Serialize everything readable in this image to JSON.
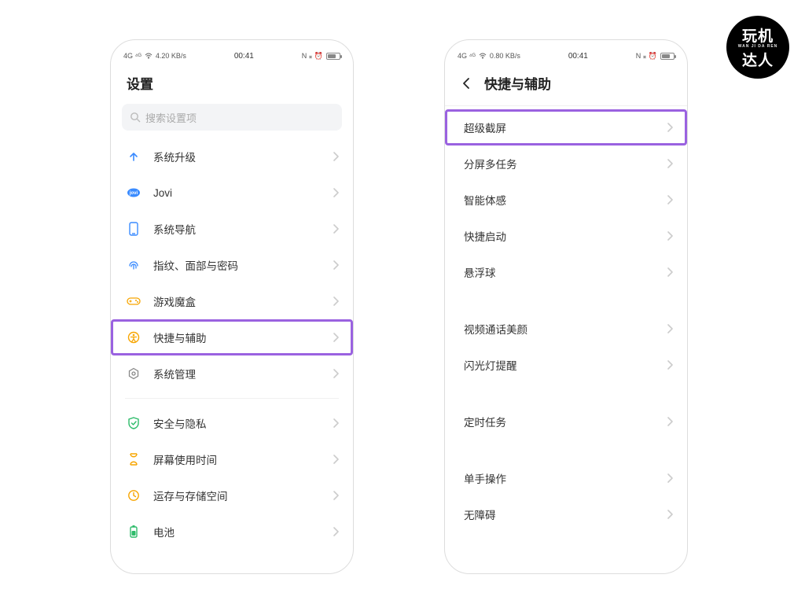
{
  "status": {
    "left_text_a": "4G ⁴ᴳ",
    "left_text_b": "4.20 KB/s",
    "left_text_b2": "0.80 KB/s",
    "time": "00:41",
    "right_icons": "N ⁎ ⏰"
  },
  "badge": {
    "line1": "玩机",
    "sub": "WAN JI DA REN",
    "line2": "达人"
  },
  "phone1": {
    "title": "设置",
    "search_placeholder": "搜索设置项",
    "groups": [
      [
        {
          "key": "upgrade",
          "label": "系统升级",
          "icon": "arrow-up",
          "color": "#3a8bff"
        },
        {
          "key": "jovi",
          "label": "Jovi",
          "icon": "jovi",
          "color": "#3a8bff"
        },
        {
          "key": "nav",
          "label": "系统导航",
          "icon": "phone-rect",
          "color": "#3a8bff"
        },
        {
          "key": "biometric",
          "label": "指纹、面部与密码",
          "icon": "fingerprint",
          "color": "#3a8bff"
        },
        {
          "key": "gamebox",
          "label": "游戏魔盒",
          "icon": "gamepad",
          "color": "#f7a500"
        },
        {
          "key": "shortcut",
          "label": "快捷与辅助",
          "icon": "accessibility",
          "color": "#f7a500",
          "highlighted": true
        },
        {
          "key": "sysmgr",
          "label": "系统管理",
          "icon": "gear-hex",
          "color": "#888"
        }
      ],
      [
        {
          "key": "security",
          "label": "安全与隐私",
          "icon": "shield",
          "color": "#2dbb6a"
        },
        {
          "key": "screentime",
          "label": "屏幕使用时间",
          "icon": "hourglass",
          "color": "#f7a500"
        },
        {
          "key": "storage",
          "label": "运存与存储空间",
          "icon": "clock-store",
          "color": "#f7a500"
        },
        {
          "key": "battery",
          "label": "电池",
          "icon": "battery",
          "color": "#2dbb6a"
        }
      ]
    ]
  },
  "phone2": {
    "title": "快捷与辅助",
    "groups": [
      [
        {
          "key": "super-screenshot",
          "label": "超级截屏",
          "highlighted": true
        },
        {
          "key": "split",
          "label": "分屏多任务"
        },
        {
          "key": "motion",
          "label": "智能体感"
        },
        {
          "key": "quicklaunch",
          "label": "快捷启动"
        },
        {
          "key": "floatball",
          "label": "悬浮球"
        }
      ],
      [
        {
          "key": "videobeauty",
          "label": "视频通话美颜"
        },
        {
          "key": "flash",
          "label": "闪光灯提醒"
        }
      ],
      [
        {
          "key": "scheduled",
          "label": "定时任务"
        }
      ],
      [
        {
          "key": "onehand",
          "label": "单手操作"
        },
        {
          "key": "accessibility",
          "label": "无障碍"
        }
      ]
    ]
  }
}
